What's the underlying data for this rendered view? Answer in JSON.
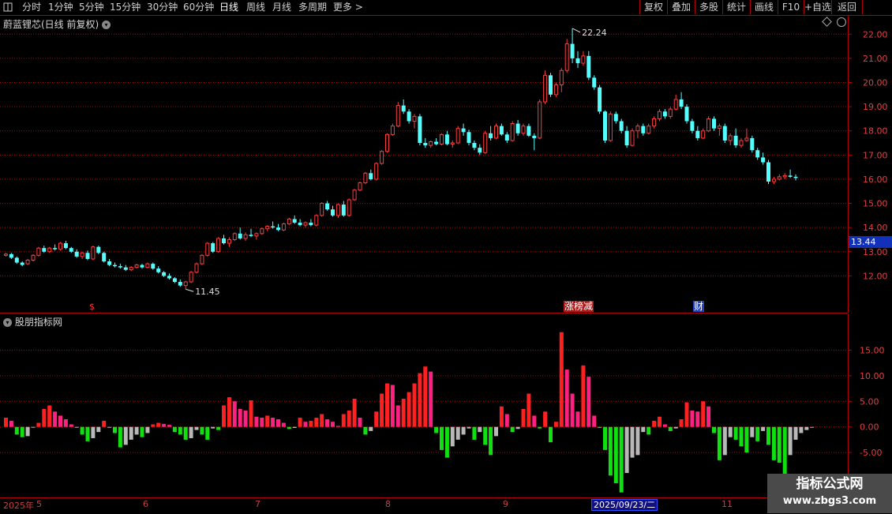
{
  "toolbar": {
    "left_items": [
      "分时",
      "1分钟",
      "5分钟",
      "15分钟",
      "30分钟",
      "60分钟",
      "日线",
      "周线",
      "月线",
      "多周期",
      "更多 >"
    ],
    "active_item": "日线",
    "right_items": [
      "复权",
      "叠加",
      "多股",
      "统计",
      "画线",
      "F10",
      "+自选",
      "返回"
    ]
  },
  "stock_title": "蔚蓝锂芯(日线 前复权)",
  "indicator_title": "股朋指标网",
  "price_axis": {
    "labels": [
      "22.00",
      "21.00",
      "20.00",
      "19.00",
      "18.00",
      "17.00",
      "16.00",
      "15.00",
      "14.00",
      "13.00",
      "12.00"
    ]
  },
  "current_price": "13.44",
  "annotations": {
    "high": "22.24",
    "low": "11.45"
  },
  "markers": {
    "dividend": "$",
    "limit": "涨榜减",
    "finance": "财"
  },
  "indicator_axis": {
    "labels": [
      "15.00",
      "10.00",
      "5.00",
      "0.00",
      "-5.00"
    ]
  },
  "date_axis": {
    "labels": [
      "2025年",
      "5",
      "6",
      "7",
      "8",
      "9",
      "11"
    ],
    "highlight": "2025/09/23/二"
  },
  "watermark": {
    "line1": "指标公式网",
    "line2": "www.zbgs3.com"
  },
  "colors": {
    "up": "#ff3c3c",
    "down": "#54ffff",
    "bg": "#000000",
    "grid": "#b00000",
    "bar_red": "#ff2020",
    "bar_pink": "#ff2080",
    "bar_green": "#10e010",
    "bar_gray": "#b8b8b8"
  },
  "chart_data": {
    "type": "candlestick",
    "ylim": [
      11.0,
      22.5
    ],
    "candles": [
      [
        12.85,
        12.95,
        12.8,
        12.9
      ],
      [
        12.9,
        12.95,
        12.7,
        12.75
      ],
      [
        12.75,
        12.8,
        12.5,
        12.55
      ],
      [
        12.55,
        12.6,
        12.4,
        12.45
      ],
      [
        12.5,
        12.7,
        12.45,
        12.65
      ],
      [
        12.65,
        12.9,
        12.6,
        12.85
      ],
      [
        12.85,
        13.2,
        12.8,
        13.15
      ],
      [
        13.15,
        13.25,
        12.95,
        13.0
      ],
      [
        13.0,
        13.2,
        12.95,
        13.15
      ],
      [
        13.15,
        13.3,
        13.05,
        13.1
      ],
      [
        13.1,
        13.4,
        13.05,
        13.35
      ],
      [
        13.35,
        13.45,
        13.1,
        13.15
      ],
      [
        13.15,
        13.2,
        12.95,
        13.0
      ],
      [
        13.0,
        13.1,
        12.75,
        12.8
      ],
      [
        12.8,
        13.0,
        12.7,
        12.95
      ],
      [
        12.95,
        13.05,
        12.65,
        12.7
      ],
      [
        12.7,
        13.25,
        12.65,
        13.2
      ],
      [
        13.2,
        13.25,
        12.9,
        12.95
      ],
      [
        12.95,
        13.0,
        12.55,
        12.6
      ],
      [
        12.6,
        12.7,
        12.4,
        12.45
      ],
      [
        12.45,
        12.55,
        12.35,
        12.4
      ],
      [
        12.4,
        12.5,
        12.3,
        12.35
      ],
      [
        12.35,
        12.45,
        12.2,
        12.25
      ],
      [
        12.25,
        12.4,
        12.2,
        12.35
      ],
      [
        12.35,
        12.5,
        12.3,
        12.45
      ],
      [
        12.45,
        12.5,
        12.3,
        12.35
      ],
      [
        12.35,
        12.55,
        12.3,
        12.5
      ],
      [
        12.5,
        12.55,
        12.25,
        12.3
      ],
      [
        12.3,
        12.4,
        12.1,
        12.15
      ],
      [
        12.15,
        12.2,
        11.95,
        12.0
      ],
      [
        12.0,
        12.1,
        11.85,
        11.9
      ],
      [
        11.9,
        11.95,
        11.7,
        11.75
      ],
      [
        11.75,
        11.85,
        11.55,
        11.6
      ],
      [
        11.6,
        11.8,
        11.45,
        11.75
      ],
      [
        11.75,
        12.2,
        11.7,
        12.15
      ],
      [
        12.15,
        12.55,
        12.1,
        12.5
      ],
      [
        12.5,
        12.9,
        12.45,
        12.85
      ],
      [
        12.85,
        13.4,
        12.8,
        13.35
      ],
      [
        13.35,
        13.4,
        12.95,
        13.0
      ],
      [
        13.0,
        13.6,
        12.95,
        13.55
      ],
      [
        13.55,
        13.7,
        13.3,
        13.35
      ],
      [
        13.35,
        13.6,
        13.2,
        13.5
      ],
      [
        13.5,
        13.8,
        13.45,
        13.75
      ],
      [
        13.75,
        14.0,
        13.5,
        13.55
      ],
      [
        13.55,
        13.8,
        13.45,
        13.7
      ],
      [
        13.7,
        13.95,
        13.6,
        13.65
      ],
      [
        13.65,
        13.8,
        13.5,
        13.75
      ],
      [
        13.75,
        14.0,
        13.7,
        13.95
      ],
      [
        13.95,
        14.1,
        13.85,
        14.05
      ],
      [
        14.05,
        14.25,
        13.95,
        14.0
      ],
      [
        14.0,
        14.15,
        13.85,
        13.9
      ],
      [
        13.9,
        14.2,
        13.85,
        14.15
      ],
      [
        14.15,
        14.4,
        14.1,
        14.35
      ],
      [
        14.35,
        14.5,
        14.15,
        14.2
      ],
      [
        14.2,
        14.35,
        14.05,
        14.1
      ],
      [
        14.1,
        14.25,
        14.0,
        14.2
      ],
      [
        14.2,
        14.35,
        14.05,
        14.1
      ],
      [
        14.1,
        14.55,
        14.05,
        14.5
      ],
      [
        14.5,
        15.05,
        14.45,
        15.0
      ],
      [
        15.0,
        15.1,
        14.7,
        14.75
      ],
      [
        14.75,
        14.9,
        14.45,
        14.5
      ],
      [
        14.5,
        15.0,
        14.4,
        14.95
      ],
      [
        14.95,
        15.1,
        14.45,
        14.5
      ],
      [
        14.5,
        15.2,
        14.45,
        15.15
      ],
      [
        15.15,
        15.6,
        15.1,
        15.55
      ],
      [
        15.55,
        15.9,
        15.5,
        15.85
      ],
      [
        15.85,
        16.3,
        15.8,
        16.25
      ],
      [
        16.25,
        16.4,
        15.95,
        16.0
      ],
      [
        16.0,
        16.7,
        15.95,
        16.65
      ],
      [
        16.65,
        17.2,
        16.6,
        17.15
      ],
      [
        17.15,
        17.9,
        17.1,
        17.85
      ],
      [
        17.85,
        18.3,
        17.8,
        18.2
      ],
      [
        18.2,
        19.2,
        18.15,
        19.05
      ],
      [
        19.05,
        19.3,
        18.7,
        18.8
      ],
      [
        18.8,
        18.9,
        18.3,
        18.4
      ],
      [
        18.4,
        18.7,
        18.1,
        18.6
      ],
      [
        18.6,
        18.7,
        17.4,
        17.5
      ],
      [
        17.5,
        17.7,
        17.3,
        17.4
      ],
      [
        17.4,
        17.6,
        17.3,
        17.55
      ],
      [
        17.55,
        17.7,
        17.4,
        17.45
      ],
      [
        17.45,
        17.9,
        17.4,
        17.85
      ],
      [
        17.85,
        18.0,
        17.4,
        17.45
      ],
      [
        17.45,
        17.6,
        17.3,
        17.5
      ],
      [
        17.5,
        18.2,
        17.45,
        18.1
      ],
      [
        18.1,
        18.3,
        17.8,
        17.95
      ],
      [
        17.95,
        18.05,
        17.4,
        17.5
      ],
      [
        17.5,
        17.6,
        17.2,
        17.3
      ],
      [
        17.3,
        17.45,
        17.0,
        17.1
      ],
      [
        17.1,
        18.0,
        17.05,
        17.9
      ],
      [
        17.9,
        18.2,
        17.6,
        17.7
      ],
      [
        17.7,
        18.3,
        17.65,
        18.2
      ],
      [
        18.2,
        18.3,
        17.8,
        17.85
      ],
      [
        17.85,
        17.95,
        17.5,
        17.6
      ],
      [
        17.6,
        18.4,
        17.55,
        18.3
      ],
      [
        18.3,
        18.45,
        17.8,
        17.9
      ],
      [
        17.9,
        18.3,
        17.8,
        18.2
      ],
      [
        18.2,
        18.3,
        17.75,
        17.8
      ],
      [
        17.8,
        17.9,
        17.2,
        17.7
      ],
      [
        17.7,
        19.3,
        17.65,
        19.2
      ],
      [
        19.2,
        20.5,
        19.1,
        20.3
      ],
      [
        20.3,
        20.4,
        19.4,
        19.5
      ],
      [
        19.5,
        20.0,
        19.4,
        19.9
      ],
      [
        19.9,
        20.6,
        19.6,
        20.5
      ],
      [
        20.5,
        21.8,
        20.4,
        21.6
      ],
      [
        21.6,
        22.24,
        20.8,
        21.0
      ],
      [
        21.0,
        21.3,
        20.6,
        20.8
      ],
      [
        20.8,
        21.3,
        20.7,
        21.1
      ],
      [
        21.1,
        21.3,
        20.1,
        20.2
      ],
      [
        20.2,
        20.3,
        19.7,
        19.8
      ],
      [
        19.8,
        19.9,
        18.7,
        18.8
      ],
      [
        18.8,
        18.85,
        17.5,
        17.6
      ],
      [
        17.6,
        18.8,
        17.55,
        18.7
      ],
      [
        18.7,
        18.8,
        18.3,
        18.4
      ],
      [
        18.4,
        18.5,
        17.9,
        18.0
      ],
      [
        18.0,
        18.2,
        17.3,
        17.4
      ],
      [
        17.4,
        18.1,
        17.35,
        18.0
      ],
      [
        18.0,
        18.3,
        17.7,
        18.2
      ],
      [
        18.2,
        18.3,
        17.8,
        17.9
      ],
      [
        17.9,
        18.3,
        17.85,
        18.2
      ],
      [
        18.2,
        18.6,
        18.1,
        18.5
      ],
      [
        18.5,
        18.9,
        18.4,
        18.8
      ],
      [
        18.8,
        18.9,
        18.5,
        18.6
      ],
      [
        18.6,
        19.0,
        18.5,
        18.9
      ],
      [
        18.9,
        19.5,
        18.85,
        19.3
      ],
      [
        19.3,
        19.6,
        18.9,
        19.0
      ],
      [
        19.0,
        19.1,
        18.3,
        18.4
      ],
      [
        18.4,
        18.5,
        17.9,
        18.0
      ],
      [
        18.0,
        18.2,
        17.6,
        17.7
      ],
      [
        17.7,
        18.1,
        17.65,
        18.0
      ],
      [
        18.0,
        18.6,
        17.95,
        18.5
      ],
      [
        18.5,
        18.6,
        18.0,
        18.1
      ],
      [
        18.1,
        18.3,
        17.8,
        18.2
      ],
      [
        18.2,
        18.3,
        17.5,
        17.6
      ],
      [
        17.6,
        17.9,
        17.4,
        17.8
      ],
      [
        17.8,
        18.1,
        17.3,
        17.4
      ],
      [
        17.4,
        17.7,
        17.3,
        17.6
      ],
      [
        17.6,
        18.1,
        17.55,
        17.7
      ],
      [
        17.7,
        17.8,
        17.1,
        17.2
      ],
      [
        17.2,
        17.3,
        16.8,
        16.9
      ],
      [
        16.9,
        17.1,
        16.6,
        16.7
      ],
      [
        16.7,
        16.8,
        15.8,
        15.9
      ],
      [
        15.9,
        16.1,
        15.8,
        16.0
      ],
      [
        16.0,
        16.2,
        15.95,
        16.1
      ],
      [
        16.1,
        16.25,
        16.0,
        16.15
      ],
      [
        16.15,
        16.4,
        16.05,
        16.1
      ],
      [
        16.1,
        16.2,
        15.95,
        16.05
      ]
    ],
    "indicator": {
      "type": "bar",
      "ylim": [
        -13.0,
        20.0
      ],
      "values": [
        1.8,
        1.2,
        -1.5,
        -2.0,
        -1.8,
        0,
        0.8,
        3.5,
        4.2,
        3.0,
        2.2,
        1.5,
        0.5,
        0,
        -1.5,
        -2.8,
        -2.2,
        -1.0,
        1.2,
        0,
        -1.2,
        -4.0,
        -3.5,
        -2.5,
        -1.5,
        -2.0,
        -1.2,
        0.5,
        0.8,
        0.6,
        0.4,
        -1.0,
        -1.5,
        -2.5,
        -2.2,
        -0.6,
        -1.5,
        -2.5,
        -0.3,
        -0.6,
        4.2,
        5.8,
        5.0,
        3.5,
        3.2,
        5.2,
        2.0,
        1.8,
        2.2,
        1.8,
        1.5,
        0.8,
        -0.4,
        -0.2,
        1.8,
        1.0,
        1.2,
        1.8,
        2.5,
        1.5,
        1.0,
        0.2,
        2.5,
        3.2,
        5.5,
        1.8,
        -1.5,
        -0.8,
        3.0,
        6.5,
        8.5,
        8.2,
        4.2,
        5.5,
        6.8,
        8.5,
        10.5,
        11.8,
        10.8,
        -1.2,
        -4.5,
        -6.0,
        -3.8,
        -2.5,
        -1.5,
        -0.3,
        -2.5,
        -1.0,
        -3.5,
        -5.5,
        -1.8,
        4.0,
        2.5,
        -1.0,
        -0.4,
        3.5,
        6.5,
        2.2,
        -0.3,
        3.0,
        -3.0,
        1.0,
        18.5,
        11.2,
        6.5,
        3.0,
        12.0,
        9.8,
        2.2,
        -0.2,
        -4.5,
        -9.5,
        -11.0,
        -12.8,
        -9.0,
        -6.0,
        -5.5,
        -1.0,
        -1.5,
        1.2,
        2.0,
        0.5,
        -0.8,
        -0.3,
        1.5,
        4.8,
        3.2,
        3.0,
        5.0,
        4.0,
        -1.2,
        -6.5,
        -5.5,
        -2.0,
        -2.5,
        -3.8,
        -5.0,
        -2.0,
        -2.8,
        -0.8,
        -3.5,
        -6.5,
        -7.0,
        -9.5,
        -5.5,
        -2.5,
        -1.2,
        -0.6,
        -0.1
      ]
    }
  }
}
